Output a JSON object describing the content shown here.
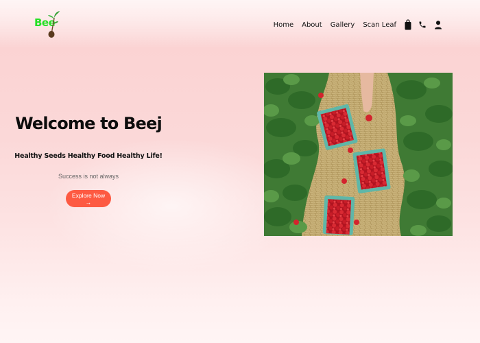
{
  "brand": {
    "logo_text": "Bee"
  },
  "nav": {
    "links": [
      "Home",
      "About",
      "Gallery",
      "Scan Leaf"
    ],
    "icons": [
      "shopping-bag-icon",
      "phone-icon",
      "user-icon"
    ]
  },
  "hero": {
    "title": "Welcome to Beej",
    "tagline": "Healthy Seeds Healthy Food Healthy Life!",
    "subtext": "Success is not always",
    "cta_label": "Explore Now →"
  },
  "colors": {
    "accent": "#fd5a42",
    "logo_green": "#25e025",
    "background": "#fbd6d6"
  }
}
